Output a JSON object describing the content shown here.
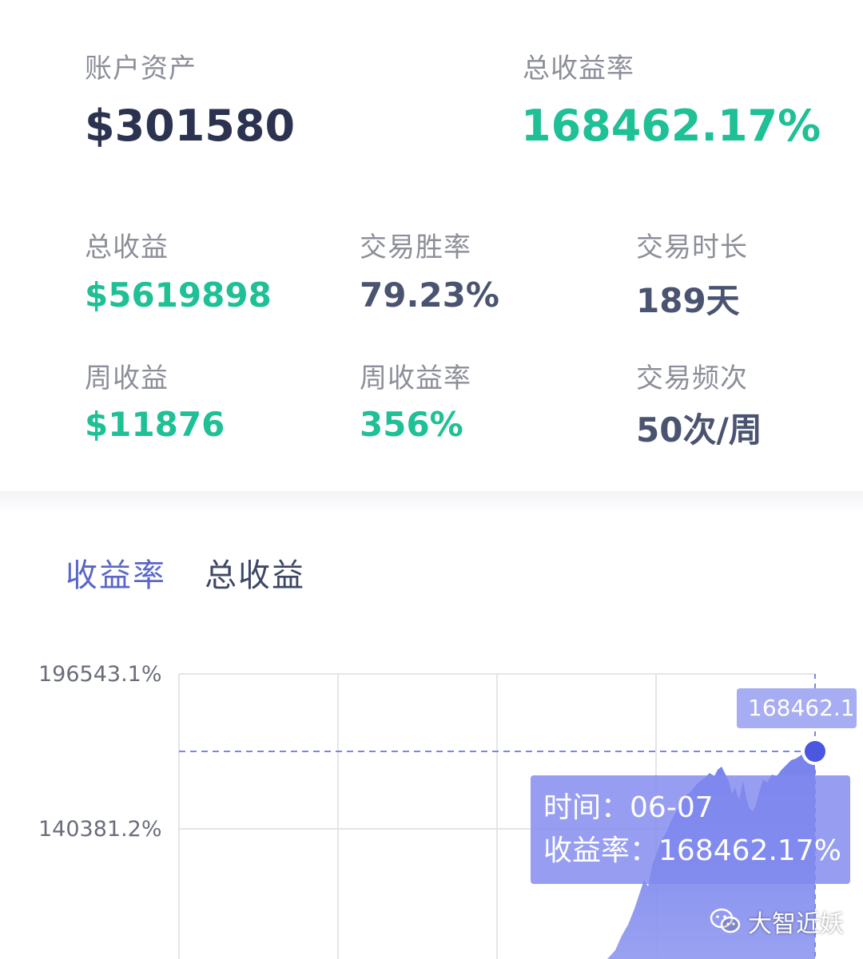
{
  "summary": {
    "assets_label": "账户资产",
    "assets_value": "$301580",
    "total_rate_label": "总收益率",
    "total_rate_value": "168462.17%"
  },
  "stats": [
    {
      "label": "总收益",
      "value": "$5619898",
      "color": "#1fc095"
    },
    {
      "label": "交易胜率",
      "value": "79.23%",
      "color": "#4a5370"
    },
    {
      "label": "交易时长",
      "value": "189天",
      "color": "#4a5370"
    },
    {
      "label": "周收益",
      "value": "$11876",
      "color": "#1fc095"
    },
    {
      "label": "周收益率",
      "value": "356%",
      "color": "#1fc095"
    },
    {
      "label": "交易频次",
      "value": "50次/周",
      "color": "#4a5370"
    }
  ],
  "tabs": [
    {
      "label": "收益率",
      "active": true
    },
    {
      "label": "总收益",
      "active": false
    }
  ],
  "chart_data": {
    "type": "area",
    "y_ticks": [
      "196543.1%",
      "140381.2%"
    ],
    "y_tick_values": [
      196543.1,
      140381.2
    ],
    "x": [
      "06-07"
    ],
    "series": [
      {
        "values": [
          168462.17
        ],
        "color": "#6f7bea"
      }
    ],
    "last_point": {
      "x": "06-07",
      "y": 168462.17
    },
    "end_label": "168462.1",
    "grid": true
  },
  "tooltip": {
    "time_label": "时间：",
    "time_value": "06-07",
    "rate_label": "收益率：",
    "rate_value": "168462.17%"
  },
  "colors": {
    "accent": "#6f7bea",
    "green": "#1fc095",
    "navy": "#2b3350"
  },
  "watermark": {
    "text": "大智近妖",
    "icon": "wechat-icon"
  }
}
